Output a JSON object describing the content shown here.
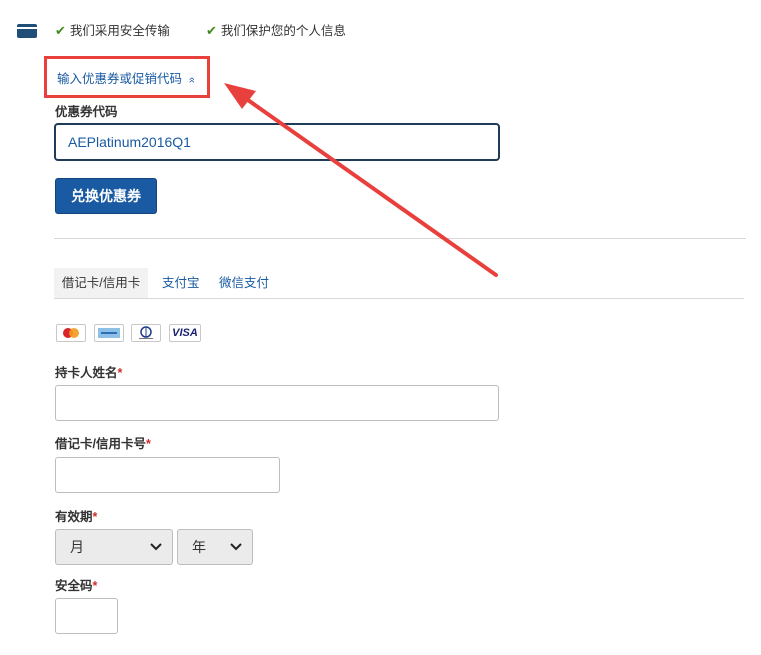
{
  "badges": [
    {
      "icon": "check-icon",
      "text": "我们采用安全传输"
    },
    {
      "icon": "check-icon",
      "text": "我们保护您的个人信息"
    }
  ],
  "coupon": {
    "toggle_label": "输入优惠券或促销代码",
    "toggle_icon": "»",
    "field_label": "优惠券代码",
    "code": "AEPlatinum2016Q1",
    "redeem_label": "兑换优惠券"
  },
  "payment_tabs": [
    "借记卡/信用卡",
    "支付宝",
    "微信支付"
  ],
  "card_brands": [
    "mastercard-icon",
    "amex-icon",
    "diners-club-icon",
    "visa-icon"
  ],
  "card_brand_text": {
    "visa": "VISA"
  },
  "form": {
    "cardholder_label": "持卡人姓名",
    "card_number_label": "借记卡/信用卡号",
    "expiry_label": "有效期",
    "month_value": "月",
    "year_value": "年",
    "cvv_label": "安全码",
    "required_mark": "*"
  },
  "colors": {
    "accent": "#1a5aa3",
    "annotation": "#e8413d",
    "check": "#3f8b1f"
  }
}
